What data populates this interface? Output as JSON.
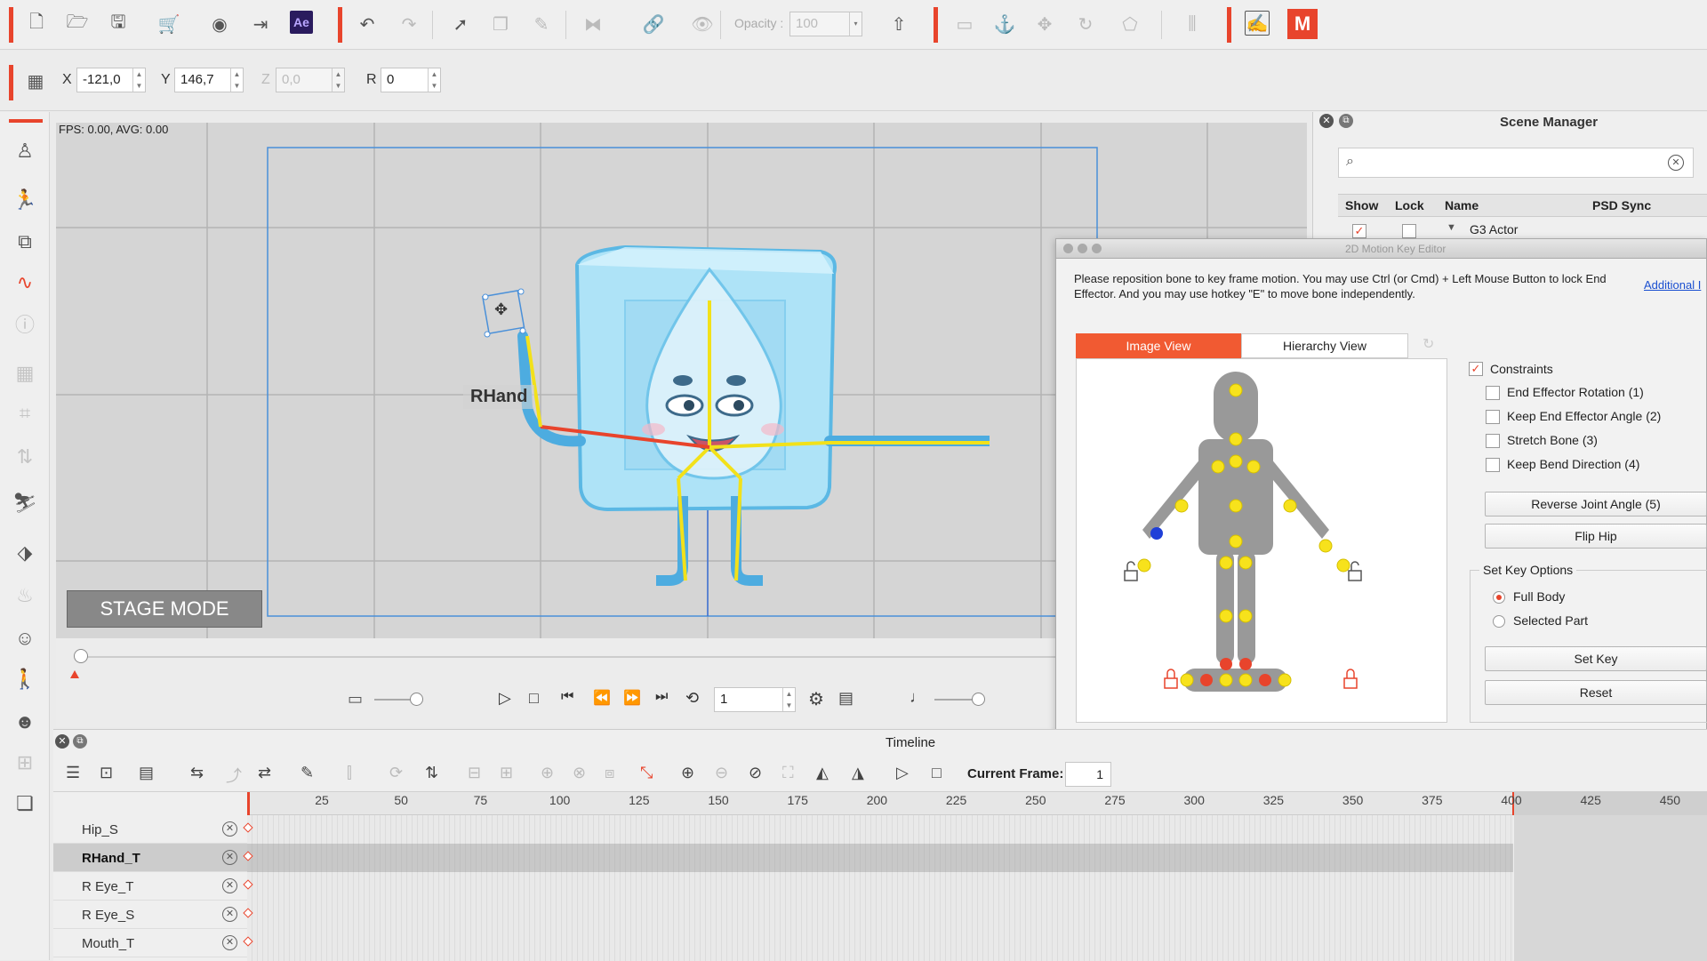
{
  "toolbar": {
    "opacity_label": "Opacity :",
    "opacity_value": "100",
    "icons": [
      "new-file",
      "open-folder",
      "save",
      "cart",
      "eye",
      "export",
      "ae",
      "undo",
      "redo",
      "select",
      "copy",
      "paint",
      "flip",
      "link",
      "visibility",
      "export-up",
      "move",
      "rotate",
      "script",
      "m-logo"
    ]
  },
  "transform": {
    "x_label": "X",
    "x_value": "-121,0",
    "y_label": "Y",
    "y_value": "146,7",
    "z_label": "Z",
    "z_value": "0,0",
    "r_label": "R",
    "r_value": "0"
  },
  "viewport": {
    "fps": "FPS: 0.00, AVG: 0.00",
    "bone_label": "RHand",
    "stage_mode": "STAGE MODE"
  },
  "playback": {
    "frame_value": "1"
  },
  "scene_manager": {
    "title": "Scene Manager",
    "search_placeholder": "",
    "columns": {
      "show": "Show",
      "lock": "Lock",
      "name": "Name",
      "psd_sync": "PSD Sync"
    },
    "row_name": "G3 Actor"
  },
  "motion_key_editor": {
    "title": "2D Motion Key Editor",
    "instruction": "Please reposition bone to key frame motion. You may use Ctrl (or Cmd) + Left Mouse Button to lock End Effector. And you may use hotkey \"E\" to move bone independently.",
    "additional_link": "Additional I",
    "tab_image": "Image View",
    "tab_hierarchy": "Hierarchy View",
    "constraints_label": "Constraints",
    "options": [
      "End Effector Rotation (1)",
      "Keep End Effector Angle (2)",
      "Stretch Bone (3)",
      "Keep Bend Direction (4)"
    ],
    "reverse_joint": "Reverse Joint Angle (5)",
    "flip_hip": "Flip Hip",
    "set_key_options": "Set Key Options",
    "full_body": "Full Body",
    "selected_part": "Selected Part",
    "set_key": "Set Key",
    "reset": "Reset"
  },
  "timeline": {
    "title": "Timeline",
    "current_frame_label": "Current Frame:",
    "current_frame_value": "1",
    "ticks": [
      "25",
      "50",
      "75",
      "100",
      "125",
      "150",
      "175",
      "200",
      "225",
      "250",
      "275",
      "300",
      "325",
      "350",
      "375",
      "400",
      "425",
      "450"
    ],
    "tracks": [
      {
        "name": "Hip_S",
        "bold": false
      },
      {
        "name": "RHand_T",
        "bold": true
      },
      {
        "name": "R Eye_T",
        "bold": false
      },
      {
        "name": "R Eye_S",
        "bold": false
      },
      {
        "name": "Mouth_T",
        "bold": false
      }
    ]
  },
  "colors": {
    "accent": "#e8442c",
    "selection": "#4a90d9",
    "joint": "#f2e11a"
  }
}
